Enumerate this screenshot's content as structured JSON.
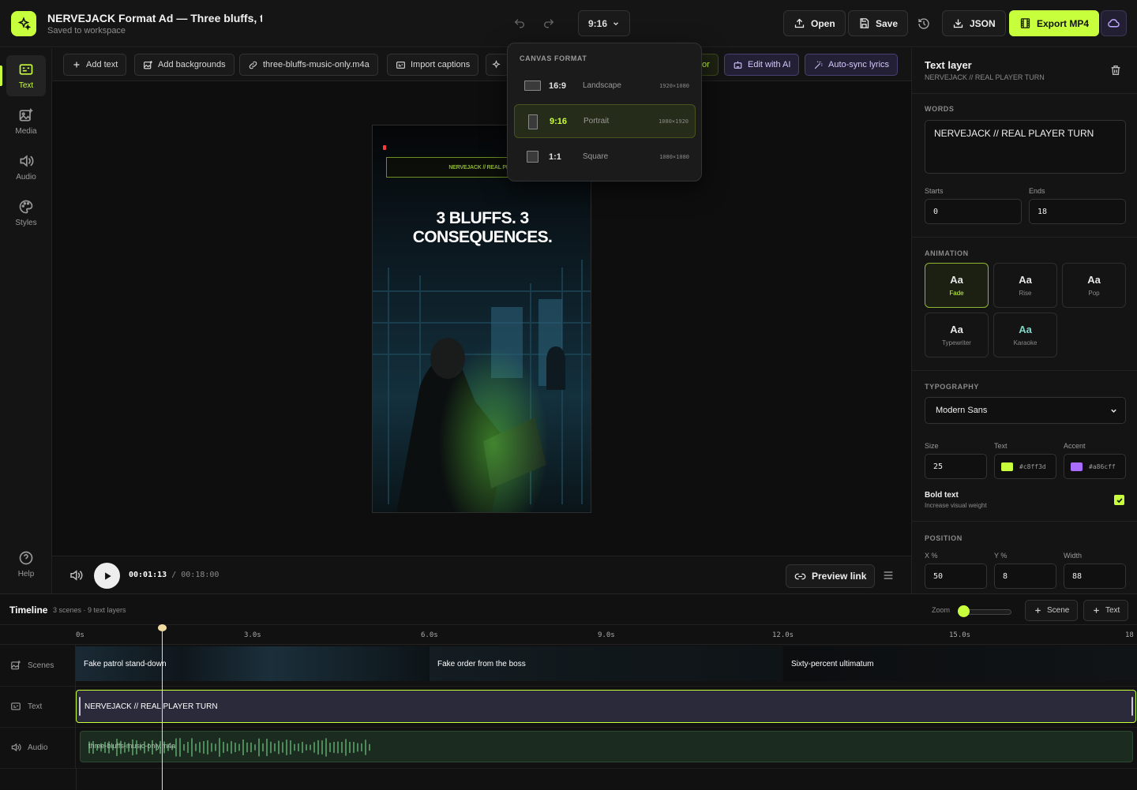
{
  "header": {
    "title": "NERVEJACK Format Ad — Three bluffs, thr",
    "subtitle": "Saved to workspace",
    "format_value": "9:16",
    "buttons": {
      "open": "Open",
      "save": "Save",
      "json": "JSON",
      "export": "Export MP4"
    }
  },
  "sidenav": {
    "items": [
      {
        "label": "Text",
        "icon": "text-icon",
        "active": true
      },
      {
        "label": "Media",
        "icon": "media-icon"
      },
      {
        "label": "Audio",
        "icon": "audio-icon"
      },
      {
        "label": "Styles",
        "icon": "palette-icon"
      }
    ],
    "help": "Help"
  },
  "toolbar": {
    "add_text": "Add text",
    "add_backgrounds": "Add backgrounds",
    "audio_file": "three-bluffs-music-only.m4a",
    "import_captions": "Import captions",
    "partial_chip": "or",
    "edit_ai": "Edit with AI",
    "auto_sync": "Auto-sync lyrics"
  },
  "canvas": {
    "band_text": "NERVEJACK // REAL PLAY",
    "headline_line1": "3 BLUFFS. 3",
    "headline_line2": "CONSEQUENCES."
  },
  "player": {
    "current": "00:01:13",
    "separator": "/",
    "total": "00:18:00",
    "preview_link": "Preview link"
  },
  "format_dropdown": {
    "heading": "CANVAS FORMAT",
    "options": [
      {
        "ratio": "16:9",
        "name": "Landscape",
        "dims": "1920×1080"
      },
      {
        "ratio": "9:16",
        "name": "Portrait",
        "dims": "1080×1920",
        "selected": true
      },
      {
        "ratio": "1:1",
        "name": "Square",
        "dims": "1080×1080"
      }
    ]
  },
  "panel": {
    "title": "Text layer",
    "subtitle": "NERVEJACK // REAL PLAYER TURN",
    "words_label": "WORDS",
    "words_value": "NERVEJACK  //  REAL PLAYER TURN",
    "starts_label": "Starts",
    "starts_value": "0",
    "ends_label": "Ends",
    "ends_value": "18",
    "animation_label": "ANIMATION",
    "animations": [
      {
        "glyph": "Aa",
        "name": "Fade",
        "selected": true
      },
      {
        "glyph": "Aa",
        "name": "Rise"
      },
      {
        "glyph": "Aa",
        "name": "Pop"
      },
      {
        "glyph": "Aa",
        "name": "Typewriter"
      },
      {
        "glyph": "Aa",
        "name": "Karaoke"
      }
    ],
    "typography_label": "TYPOGRAPHY",
    "font_value": "Modern Sans",
    "size_label": "Size",
    "size_value": "25",
    "text_label": "Text",
    "text_color": "#c8ff3d",
    "accent_label": "Accent",
    "accent_color": "#a86cff",
    "bold_label": "Bold text",
    "bold_sub": "Increase visual weight",
    "bold_checked": true,
    "position_label": "POSITION",
    "x_label": "X %",
    "x_value": "50",
    "y_label": "Y %",
    "y_value": "8",
    "width_label": "Width",
    "width_value": "88"
  },
  "timeline": {
    "title": "Timeline",
    "meta": "3 scenes · 9 text layers",
    "zoom_label": "Zoom",
    "add_scene": "Scene",
    "add_text": "Text",
    "ticks": [
      "0s",
      "3.0s",
      "6.0s",
      "9.0s",
      "12.0s",
      "15.0s",
      "18"
    ],
    "rows": {
      "scenes": "Scenes",
      "text": "Text",
      "audio": "Audio"
    },
    "scenes": [
      {
        "label": "Fake patrol stand-down"
      },
      {
        "label": "Fake order from the boss"
      },
      {
        "label": "Sixty-percent ultimatum"
      }
    ],
    "text_clip": "NERVEJACK // REAL PLAYER TURN",
    "audio_clip": "three-bluffs-music-only.m4a"
  },
  "colors": {
    "accent": "#c8ff3d",
    "purple": "#a86cff"
  }
}
